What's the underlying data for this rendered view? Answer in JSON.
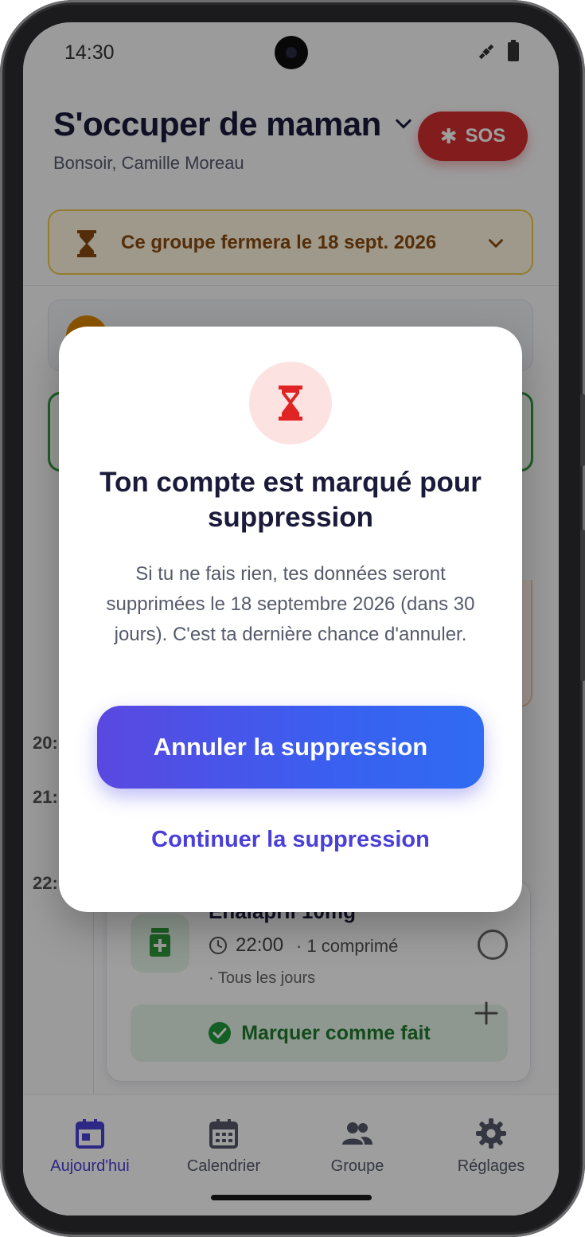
{
  "status_bar": {
    "time": "14:30"
  },
  "header": {
    "title": "S'occuper de maman",
    "greeting": "Bonsoir, Camille Moreau",
    "sos_label": "SOS"
  },
  "banner": {
    "text": "Ce groupe fermera le 18 sept. 2026"
  },
  "timeline": {
    "labels": [
      "20:",
      "21:",
      "22:"
    ]
  },
  "medication": {
    "name": "Enalapril 10mg",
    "time": "22:00",
    "dose": "· 1 comprimé",
    "frequency": "· Tous les jours",
    "mark_done_label": "Marquer comme fait"
  },
  "bottom_nav": {
    "items": [
      {
        "label": "Aujourd'hui",
        "icon": "calendar-today-icon",
        "active": true
      },
      {
        "label": "Calendrier",
        "icon": "calendar-month-icon",
        "active": false
      },
      {
        "label": "Groupe",
        "icon": "group-icon",
        "active": false
      },
      {
        "label": "Réglages",
        "icon": "gear-icon",
        "active": false
      }
    ]
  },
  "modal": {
    "icon": "hourglass-icon",
    "title": "Ton compte est marqué pour suppression",
    "body": "Si tu ne fais rien, tes données seront supprimées le 18 septembre 2026 (dans 30 jours). C'est ta dernière chance d'annuler.",
    "primary_label": "Annuler la suppression",
    "secondary_label": "Continuer la suppression"
  },
  "colors": {
    "accent": "#4a3fd8",
    "sos": "#d32f2f",
    "banner_bg": "#fff7e0",
    "banner_text": "#8a4a10",
    "success": "#1f7a2c",
    "danger_icon": "#e02424"
  }
}
